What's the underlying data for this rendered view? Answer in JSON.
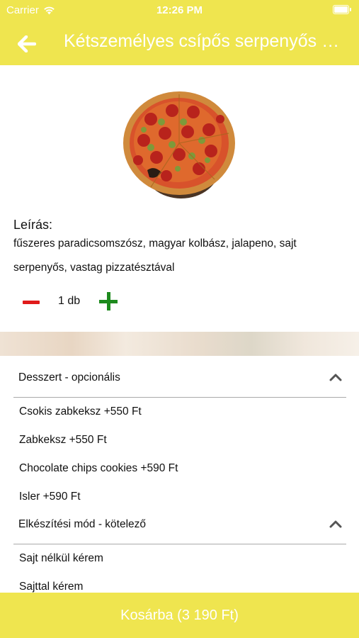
{
  "status_bar": {
    "carrier": "Carrier",
    "time": "12:26 PM"
  },
  "header": {
    "title": "Kétszemélyes csípős serpenyős pizza"
  },
  "product": {
    "description_label": "Leírás:",
    "description": "fűszeres paradicsomszósz, magyar kolbász, jalapeno, sajt serpenyős, vastag pizzatésztával",
    "quantity": "1 db"
  },
  "sections": [
    {
      "title": "Desszert - opcionális",
      "items": [
        "Csokis zabkeksz +550 Ft",
        "Zabkeksz +550 Ft",
        "Chocolate chips cookies +590 Ft",
        "Isler +590 Ft"
      ]
    },
    {
      "title": "Elkészítési mód - kötelező",
      "items": [
        "Sajt nélkül kérem",
        "Sajttal kérem"
      ]
    }
  ],
  "cart_button": {
    "label": "Kosárba (3 190 Ft)"
  },
  "colors": {
    "brand_yellow": "#efe54f",
    "minus": "#e01b1b",
    "plus": "#1d8a1d"
  }
}
